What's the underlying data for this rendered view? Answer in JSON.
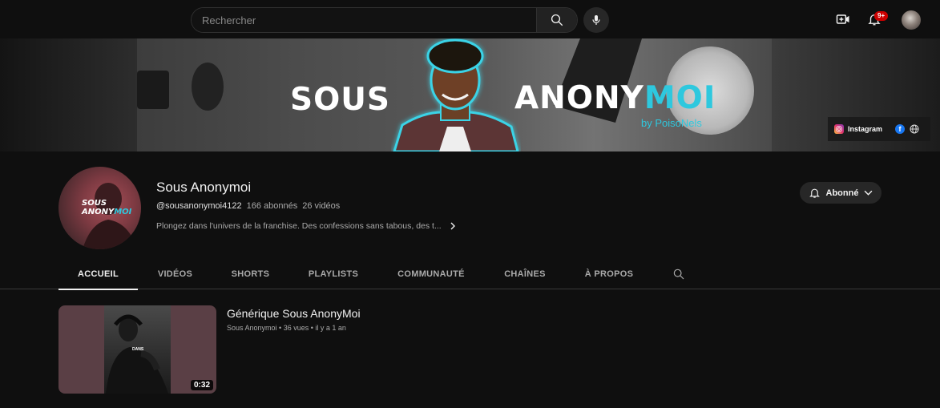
{
  "topbar": {
    "search_placeholder": "Rechercher",
    "notification_count": "9+"
  },
  "banner": {
    "word_left": "SOUS",
    "word_right_white": "ANONY",
    "word_right_accent": "MOI",
    "subtitle": "by PoisoNels",
    "accent_color": "#2ec8de",
    "links": {
      "instagram_label": "Instagram"
    }
  },
  "channel": {
    "avatar_text_line1": "SOUS",
    "avatar_text_line2_white": "ANONY",
    "avatar_text_line2_accent": "MOI",
    "name": "Sous Anonymoi",
    "handle": "@sousanonymoi4122",
    "subscribers": "166 abonnés",
    "video_count": "26 vidéos",
    "description": "Plongez dans l'univers de la franchise. Des confessions sans tabous, des t...",
    "subscribe_label": "Abonné"
  },
  "tabs": [
    {
      "label": "ACCUEIL",
      "active": true
    },
    {
      "label": "VIDÉOS",
      "active": false
    },
    {
      "label": "SHORTS",
      "active": false
    },
    {
      "label": "PLAYLISTS",
      "active": false
    },
    {
      "label": "COMMUNAUTÉ",
      "active": false
    },
    {
      "label": "CHAÎNES",
      "active": false
    },
    {
      "label": "À PROPOS",
      "active": false
    }
  ],
  "featured_video": {
    "title": "Générique Sous AnonyMoi",
    "meta": "Sous Anonymoi • 36 vues • il y a 1 an",
    "duration": "0:32",
    "thumb_overlay_text": "DANS"
  }
}
